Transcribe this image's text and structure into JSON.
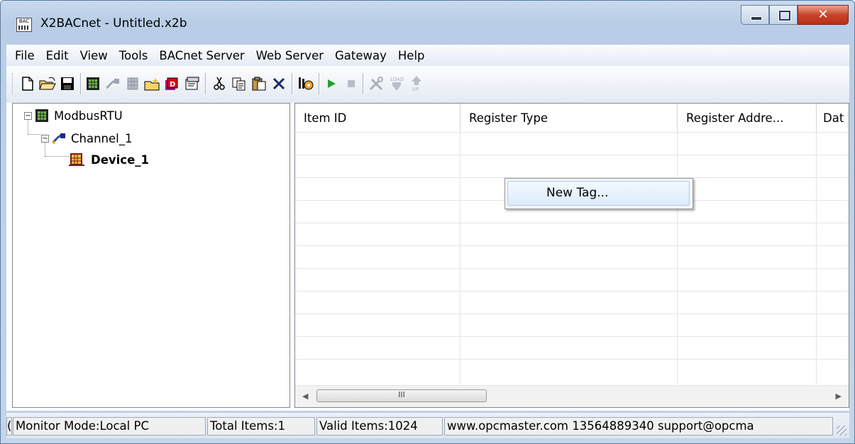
{
  "window": {
    "title": "X2BACnet - Untitled.x2b",
    "app_icon_text": "BAC"
  },
  "menu": [
    "File",
    "Edit",
    "View",
    "Tools",
    "BACnet Server",
    "Web Server",
    "Gateway",
    "Help"
  ],
  "toolbar": {
    "icons": [
      "new-file-icon",
      "open-folder-icon",
      "save-icon",
      "device-icon",
      "channel-icon",
      "tag-icon",
      "new-channel-icon",
      "new-device-icon",
      "properties-icon",
      "cut-icon",
      "copy-icon",
      "paste-icon",
      "delete-icon",
      "settings-icon",
      "run-icon",
      "stop-icon",
      "tools-icon",
      "load-icon",
      "upload-icon"
    ],
    "load_label": "LOAD",
    "up_label": "UP"
  },
  "tree": {
    "root": "ModbusRTU",
    "channel": "Channel_1",
    "device": "Device_1"
  },
  "list": {
    "columns": [
      "Item ID",
      "Register Type",
      "Register Addre...",
      "Dat"
    ]
  },
  "context_menu": {
    "new_tag": "New Tag..."
  },
  "scrollbar": {
    "thumb_grip": "III"
  },
  "status": {
    "clip": "(",
    "monitor_mode": "Monitor Mode:Local PC",
    "total_items": "Total Items:1",
    "valid_items": "Valid Items:1024",
    "contact": "www.opcmaster.com 13564889340 support@opcma"
  }
}
